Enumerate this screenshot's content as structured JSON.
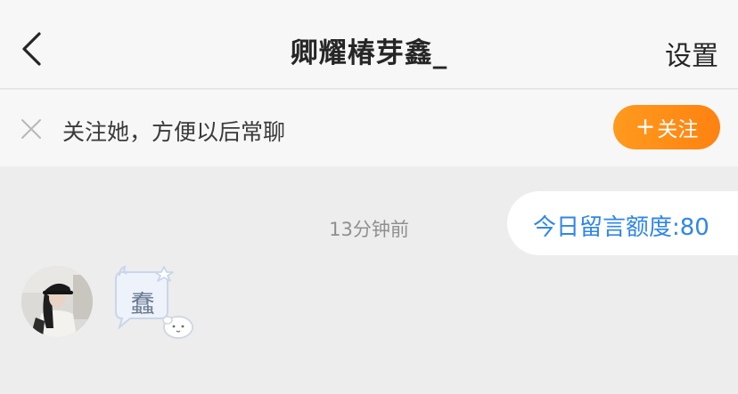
{
  "header": {
    "title": "卿耀椿芽鑫_",
    "settings_label": "设置"
  },
  "follow_bar": {
    "prompt": "关注她，方便以后常聊",
    "button_plus": "+",
    "button_label": "关注"
  },
  "chat": {
    "timestamp": "13分钟前",
    "quota_text": "今日留言额度:80",
    "sender_badge_char": "蠢"
  },
  "colors": {
    "accent_orange": "#ff8c16",
    "link_blue": "#2f86e8",
    "background": "#ededed",
    "bar_background": "#f7f7f7"
  },
  "icons": {
    "back": "chevron-left-icon",
    "close": "close-icon"
  }
}
